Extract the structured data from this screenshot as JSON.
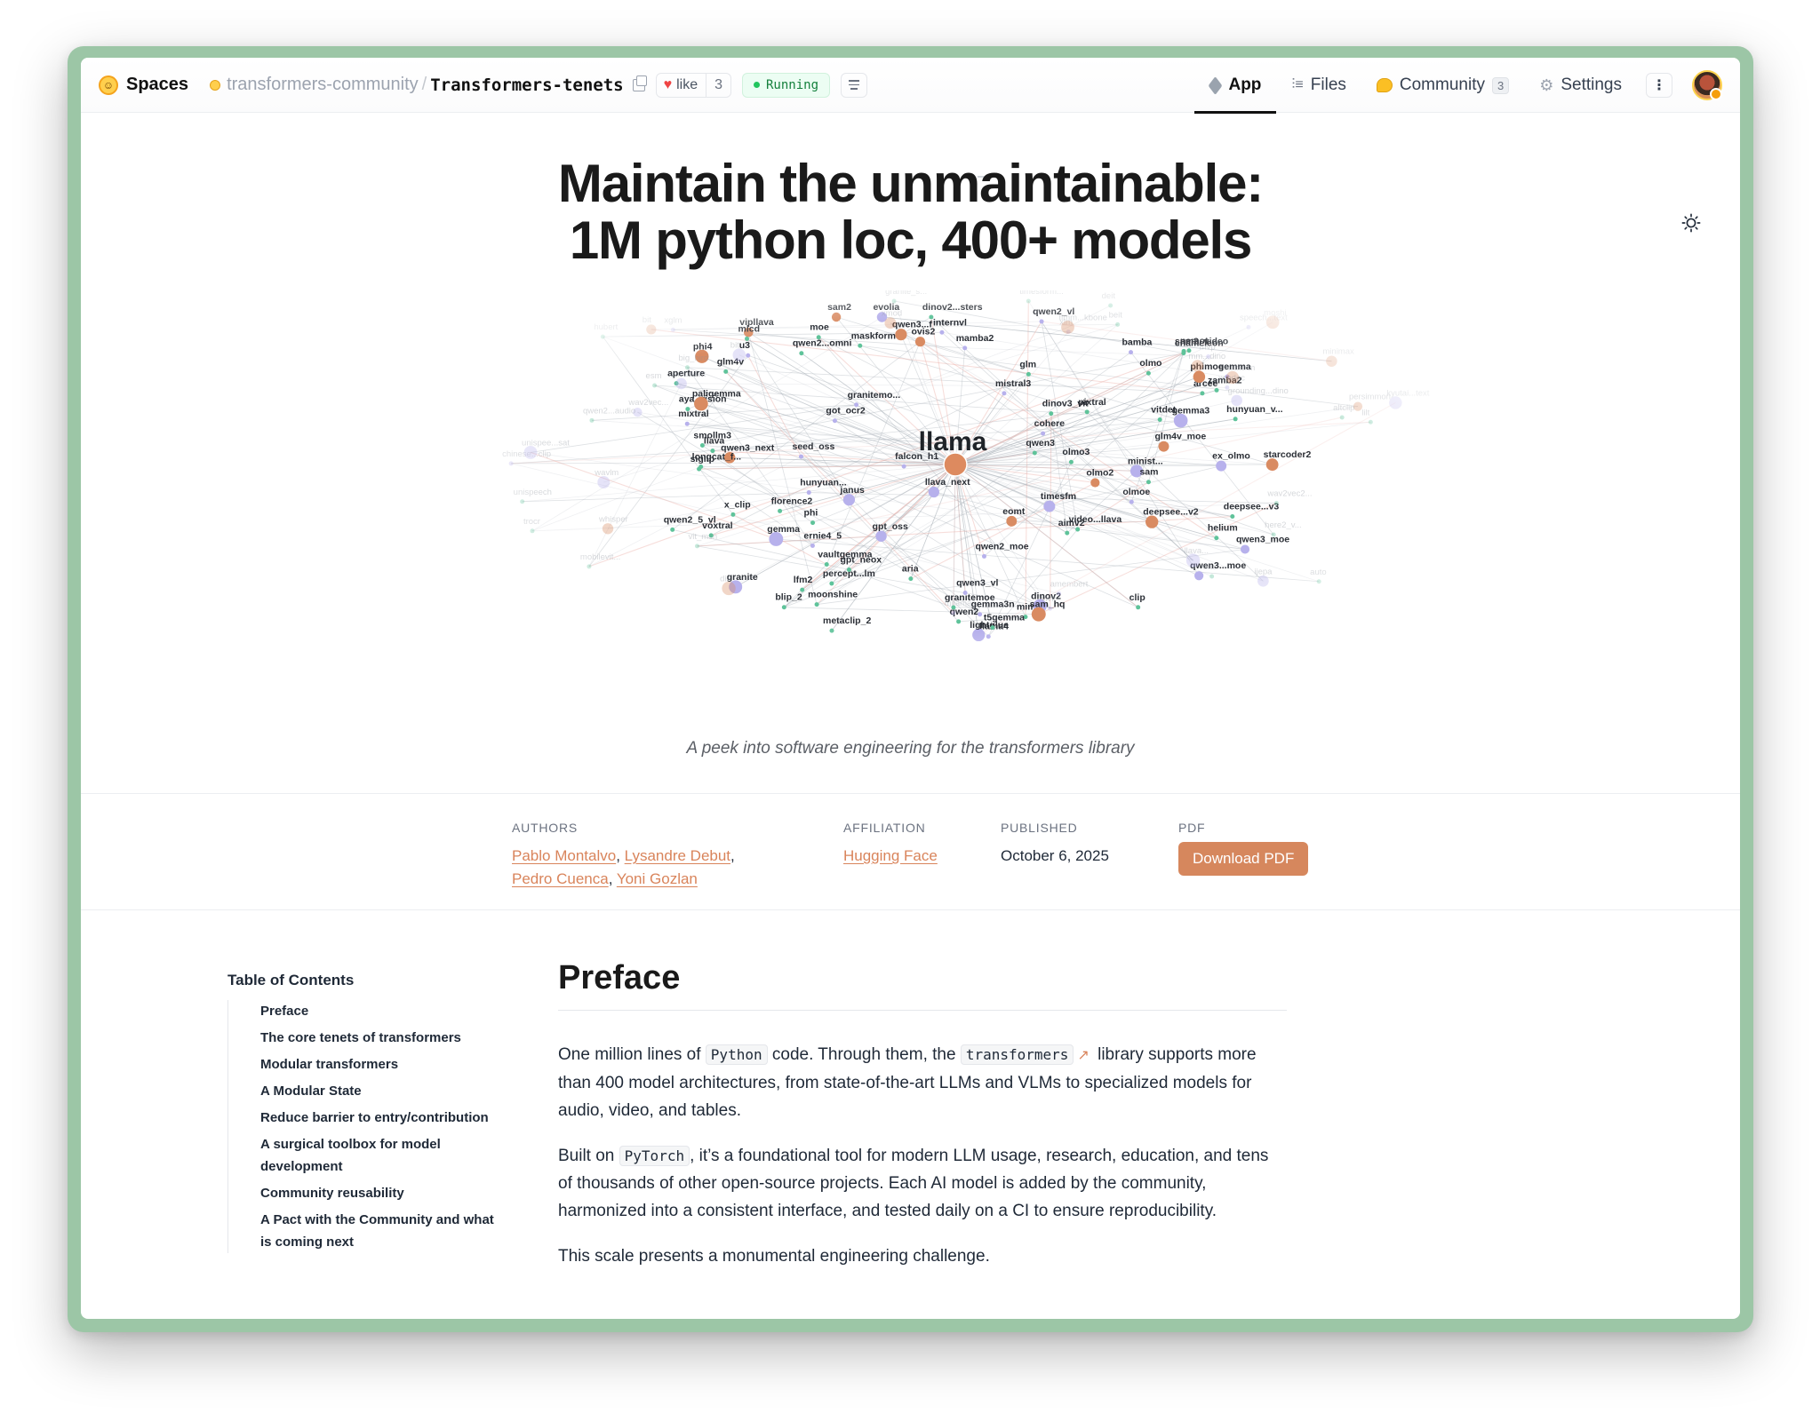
{
  "header": {
    "brand": "Spaces",
    "org": "transformers-community",
    "repo": "Transformers-tenets",
    "like_label": "like",
    "like_count": "3",
    "status": "Running",
    "nav": [
      {
        "label": "App",
        "icon": "cube-icon"
      },
      {
        "label": "Files",
        "icon": "files-icon"
      },
      {
        "label": "Community",
        "icon": "community-icon",
        "badge": "3"
      },
      {
        "label": "Settings",
        "icon": "gear-icon"
      }
    ]
  },
  "hero": {
    "title_line1": "Maintain the unmaintainable:",
    "title_line2": "1M python loc, 400+ models",
    "caption": "A peek into software engineering for the transformers library",
    "center_label": "llama"
  },
  "graph": {
    "strong": [
      "starcoder2",
      "mimi",
      "moonshine",
      "mixtral",
      "glm",
      "evolia",
      "maskformer",
      "mistral3",
      "arcee",
      "aperture",
      "ernie4_5",
      "gpt_oss",
      "florence2",
      "aya_vision",
      "olmoe",
      "qwen3_next",
      "cohere",
      "lfm2",
      "seed_oss",
      "aria",
      "percept...lm",
      "llama4",
      "bamba",
      "llava",
      "vitdet",
      "granitemoe",
      "gpt_neox",
      "dinov3_vit",
      "deepsee...v2",
      "qwen3_moe",
      "granitemo...",
      "got_ocr2",
      "nemot",
      "phimoe",
      "minist...",
      "ex_olmo",
      "internvl",
      "lightglue",
      "granite",
      "falcon_h1",
      "vipllava",
      "pixtral",
      "paligemma",
      "qwen2_moe",
      "deepsee...v3",
      "qwen3...f",
      "qwen3...moe",
      "sam2",
      "sam2_video",
      "hunyuan_v...",
      "qwen2",
      "phi",
      "olmo",
      "u3",
      "ovis2",
      "metaclip_2",
      "mlcd",
      "dinov2",
      "longcat_f...",
      "gemma3",
      "hunyuan...",
      "smollm3",
      "mamba2",
      "sam",
      "sam_hq",
      "gemma3n",
      "helium",
      "gemma",
      "qwen3",
      "glm4v",
      "olmo2",
      "timesfm",
      "phi4",
      "aimv2",
      "qwen3_vl",
      "voxtral",
      "gemma",
      "t5gemma",
      "clip",
      "video...llava",
      "eomt",
      "qwen2...omni",
      "olmo3",
      "llava_next",
      "janus",
      "zamba2",
      "qwen2_5_vl",
      "qwen2_vl",
      "vaultgemma",
      "siglip",
      "moe",
      "chameleon",
      "x_clip",
      "glm4v_moe",
      "blip_2",
      "dinov2...sters"
    ],
    "faded": [
      "vivit",
      "auto",
      "xglm",
      "trocr",
      "mvp",
      "whisper",
      "esm",
      "beit",
      "mm...dino",
      "grounding...dino",
      "vit_msn",
      "stablelm",
      "persimmon",
      "ijepa",
      "deit",
      "dac",
      "altclip",
      "timesform...",
      "mobilevit",
      "big_bird",
      "milama",
      "bit",
      "xcodec",
      "mobilevit...",
      "xlm",
      "chinese...clip",
      "speech...text",
      "minimax",
      "xmod",
      "kyutai...text",
      "here2_v...",
      "moshi",
      "amembert",
      "wav2vec...",
      "wavlm",
      "wav2vec2...",
      "unispeech",
      "unispee...sat",
      "hubert",
      "lilt",
      "timm...kbone",
      "granite_s...",
      "qwen2...audio",
      "llava...",
      "dia",
      "bit"
    ]
  },
  "meta": {
    "authors_label": "AUTHORS",
    "authors": [
      "Pablo Montalvo",
      "Lysandre Debut",
      "Pedro Cuenca",
      "Yoni Gozlan"
    ],
    "affiliation_label": "AFFILIATION",
    "affiliation": "Hugging Face",
    "published_label": "PUBLISHED",
    "published": "October 6, 2025",
    "pdf_label": "PDF",
    "pdf_button": "Download PDF"
  },
  "toc": {
    "title": "Table of Contents",
    "items": [
      "Preface",
      "The core tenets of transformers",
      "Modular transformers",
      "A Modular State",
      "Reduce barrier to entry/contribution",
      "A surgical toolbox for model development",
      "Community reusability",
      "A Pact with the Community and what is coming next"
    ]
  },
  "article": {
    "heading": "Preface",
    "p1_a": "One million lines of ",
    "p1_code1": "Python",
    "p1_b": " code. Through them, the ",
    "p1_code2": "transformers",
    "p1_c": " library supports more than 400 model architectures, from state-of-the-art LLMs and VLMs to specialized models for audio, video, and tables.",
    "p2_a": "Built on ",
    "p2_code": "PyTorch",
    "p2_b": ", it’s a foundational tool for modern LLM usage, research, education, and tens of thousands of other open-source projects. Each AI model is added by the community, harmonized into a consistent interface, and tested daily on a CI to ensure reproducibility.",
    "p3": "This scale presents a monumental engineering challenge."
  },
  "colors": {
    "accent": "#d6875d",
    "running": "#15803d",
    "frame": "#9cc6a6"
  }
}
